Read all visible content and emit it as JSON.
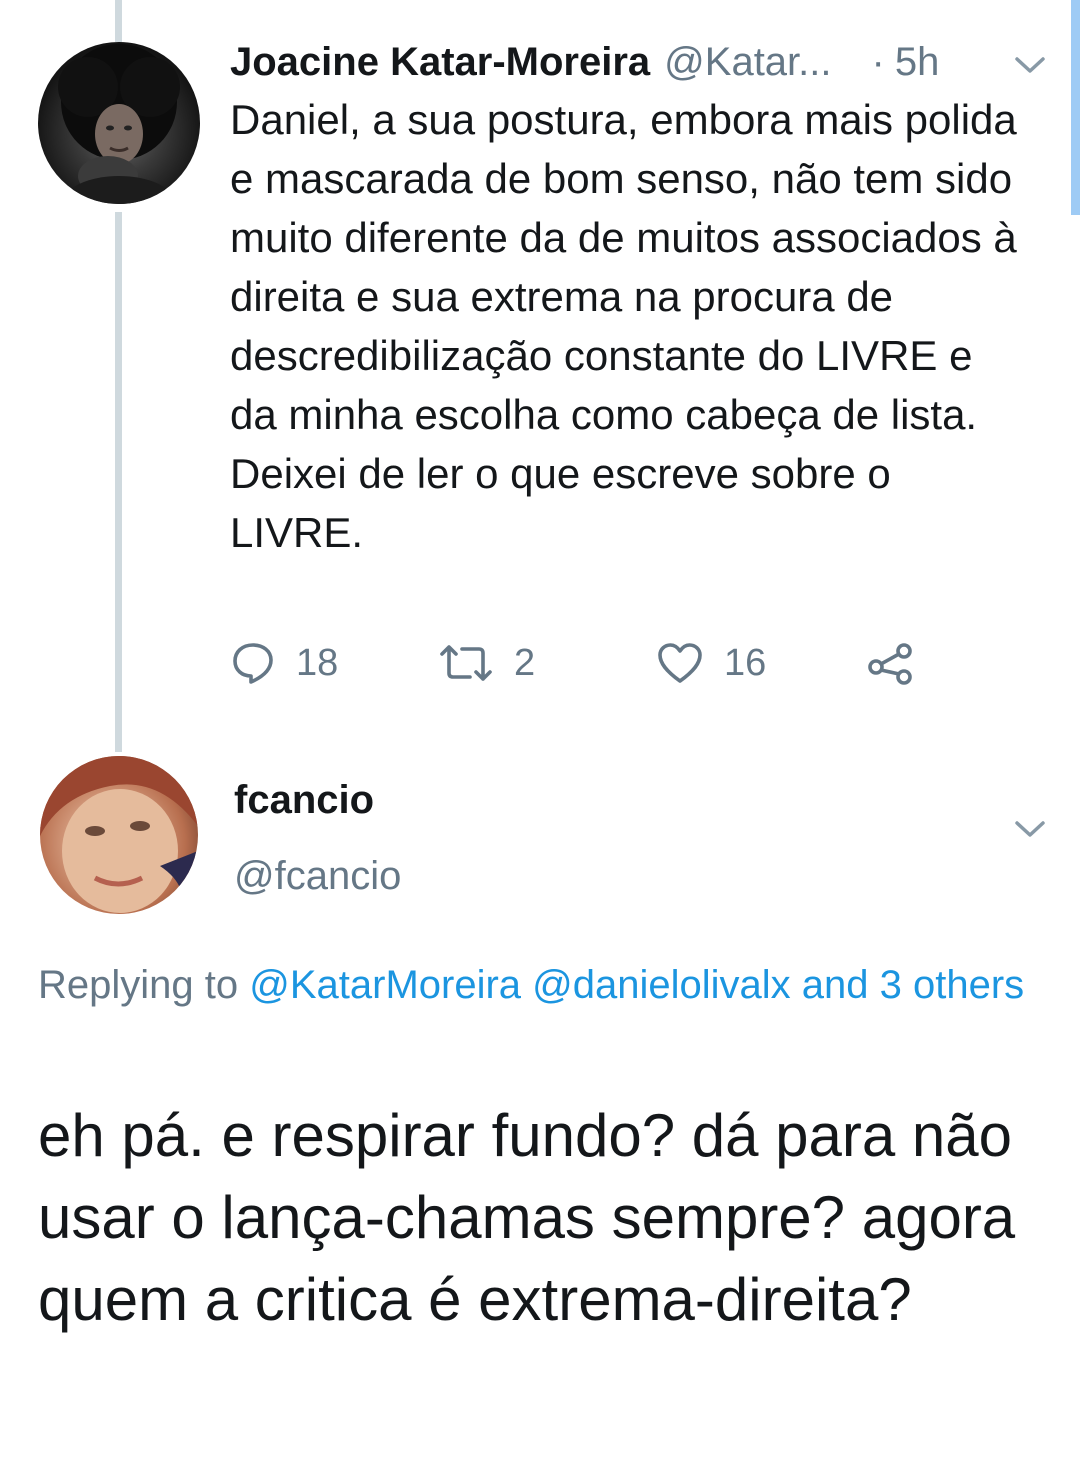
{
  "tweet_1": {
    "author_name": "Joacine Katar-Moreira",
    "author_handle": "@Katar...",
    "separator": "·",
    "time": "5h",
    "text": "Daniel, a sua postura, embora mais polida e mascarada de bom senso, não tem sido muito diferente da de muitos associados à direita e sua extrema na procura de descredibilização constante do LIVRE e da minha escolha como cabeça de lista. Deixei de ler o que escreve sobre o LIVRE.",
    "actions": {
      "reply_count": "18",
      "retweet_count": "2",
      "like_count": "16"
    }
  },
  "tweet_2": {
    "author_name": "fcancio",
    "author_handle": "@fcancio",
    "replying_prefix": "Replying to ",
    "replying_mentions": "@KatarMoreira @danielolivalx and 3 others",
    "text": "eh pá. e respirar fundo? dá para não usar o lança-chamas sempre? agora quem a critica é extrema-direita?"
  },
  "icons": {
    "caret": "chevron-down-icon",
    "reply": "reply-icon",
    "retweet": "retweet-icon",
    "like": "heart-icon",
    "share": "share-icon"
  },
  "colors": {
    "text_primary": "#14171a",
    "text_secondary": "#657786",
    "link": "#1b95e0",
    "thread_line": "#cfd9de"
  }
}
